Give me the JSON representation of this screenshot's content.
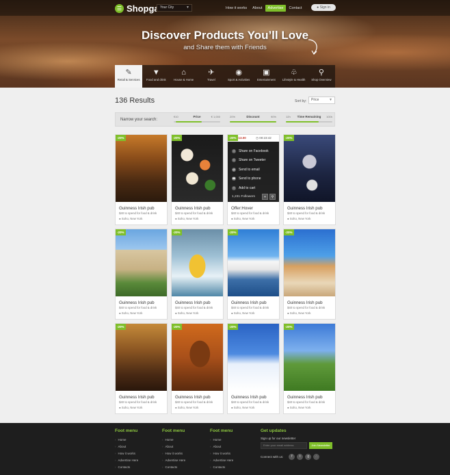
{
  "header": {
    "logo": "Shopgate",
    "city": "Your City",
    "nav": [
      {
        "label": "How it works",
        "active": false
      },
      {
        "label": "About",
        "active": false
      },
      {
        "label": "Advertise",
        "active": true
      },
      {
        "label": "Contact",
        "active": false
      }
    ],
    "signin": "Sign in"
  },
  "hero": {
    "title": "Discover Products You’ll Love",
    "subtitle": "and Share them with Friends"
  },
  "categories": [
    {
      "label": "Retail & Services",
      "icon": "tag-icon",
      "active": true
    },
    {
      "label": "Food and drink",
      "icon": "ice-cream-icon",
      "active": false
    },
    {
      "label": "House & Home",
      "icon": "house-icon",
      "active": false
    },
    {
      "label": "Travel",
      "icon": "plane-icon",
      "active": false
    },
    {
      "label": "Sport & Activities",
      "icon": "ball-icon",
      "active": false
    },
    {
      "label": "Entertainment",
      "icon": "clapper-icon",
      "active": false
    },
    {
      "label": "Lifestyle & Health",
      "icon": "bottle-icon",
      "active": false
    },
    {
      "label": "Shop Overview",
      "icon": "search-icon",
      "active": false
    }
  ],
  "results": {
    "title": "136 Results",
    "sort_label": "Sort by:",
    "sort_value": "Price"
  },
  "filters": {
    "narrow_label": "Narrow your search:",
    "sliders": [
      {
        "name": "Price",
        "min": "€10",
        "max": "€ 1,000",
        "fill_start": 0.05,
        "fill_end": 0.6
      },
      {
        "name": "Discount",
        "min": "20%",
        "max": "90%",
        "fill_start": 0.0,
        "fill_end": 1.0
      },
      {
        "name": "Time Remaining",
        "min": "12h",
        "max": "100h",
        "fill_start": 0.0,
        "fill_end": 0.7
      }
    ]
  },
  "overlay": {
    "price": "€13.00",
    "timer": "00:23:42",
    "menu": [
      "Share on Facebook",
      "Share on Tweeter",
      "Send to email",
      "Send to phone",
      "Add to cart"
    ],
    "followers": "1,231 Followers"
  },
  "cards": [
    {
      "badge": "-20%",
      "title": "Guinness Irish pub",
      "desc": "$40 to spend for food & drink",
      "location": "Soho, New York",
      "scene": "pub"
    },
    {
      "badge": "-20%",
      "title": "Guinness Irish pub",
      "desc": "$40 to spend for food & drink",
      "location": "Soho, New York",
      "scene": "sushi"
    },
    {
      "badge": "-20%",
      "title": "Offer:Hover",
      "desc": "$40 to spend for food & drink",
      "location": "Soho, New York",
      "scene": "hover"
    },
    {
      "badge": "-20%",
      "title": "Guinness Irish pub",
      "desc": "$40 to spend for food & drink",
      "location": "Soho, New York",
      "scene": "cinema"
    },
    {
      "badge": "-20%",
      "title": "Guinness Irish pub",
      "desc": "$40 to spend for food & drink",
      "location": "Soho, New York",
      "scene": "hotel"
    },
    {
      "badge": "-20%",
      "title": "Guinness Irish pub",
      "desc": "$40 to spend for food & drink",
      "location": "Soho, New York",
      "scene": "rafting"
    },
    {
      "badge": "-20%",
      "title": "Guinness Irish pub",
      "desc": "$40 to spend for food & drink",
      "location": "Soho, New York",
      "scene": "cruise"
    },
    {
      "badge": "-20%",
      "title": "Guinness Irish pub",
      "desc": "$40 to spend for food & drink",
      "location": "Soho, New York",
      "scene": "shopping"
    },
    {
      "badge": "-20%",
      "title": "Guinness Irish pub",
      "desc": "$40 to spend for food & drink",
      "location": "Soho, New York",
      "scene": "bar"
    },
    {
      "badge": "-20%",
      "title": "Guinness Irish pub",
      "desc": "$40 to spend for food & drink",
      "location": "Soho, New York",
      "scene": "gavel"
    },
    {
      "badge": "-20%",
      "title": "Guinness Irish pub",
      "desc": "$40 to spend for food & drink",
      "location": "Soho, New York",
      "scene": "snowboard"
    },
    {
      "badge": "-20%",
      "title": "Guinness Irish pub",
      "desc": "$40 to spend for food & drink",
      "location": "Soho, New York",
      "scene": "golf"
    }
  ],
  "footer": {
    "menus": [
      {
        "title": "Foot menu",
        "links": [
          "Home",
          "About",
          "How it works",
          "Advertise Here",
          "Contacts"
        ]
      },
      {
        "title": "Foot menu",
        "links": [
          "Home",
          "About",
          "How it works",
          "Advertise Here",
          "Contacts"
        ]
      },
      {
        "title": "Foot menu",
        "links": [
          "Home",
          "About",
          "How it works",
          "Advertise Here",
          "Contacts"
        ]
      }
    ],
    "updates": {
      "title": "Get updates",
      "newsletter_label": "Sign up for our newsletter",
      "placeholder": "Enter your email address",
      "button": "Join Newsletter",
      "connect": "Connect with us:",
      "socials": [
        "facebook-icon",
        "twitter-icon",
        "google-plus-icon",
        "rss-icon"
      ]
    }
  },
  "colors": {
    "accent": "#7fbf2a",
    "footer_bg": "#1e1e1e"
  }
}
